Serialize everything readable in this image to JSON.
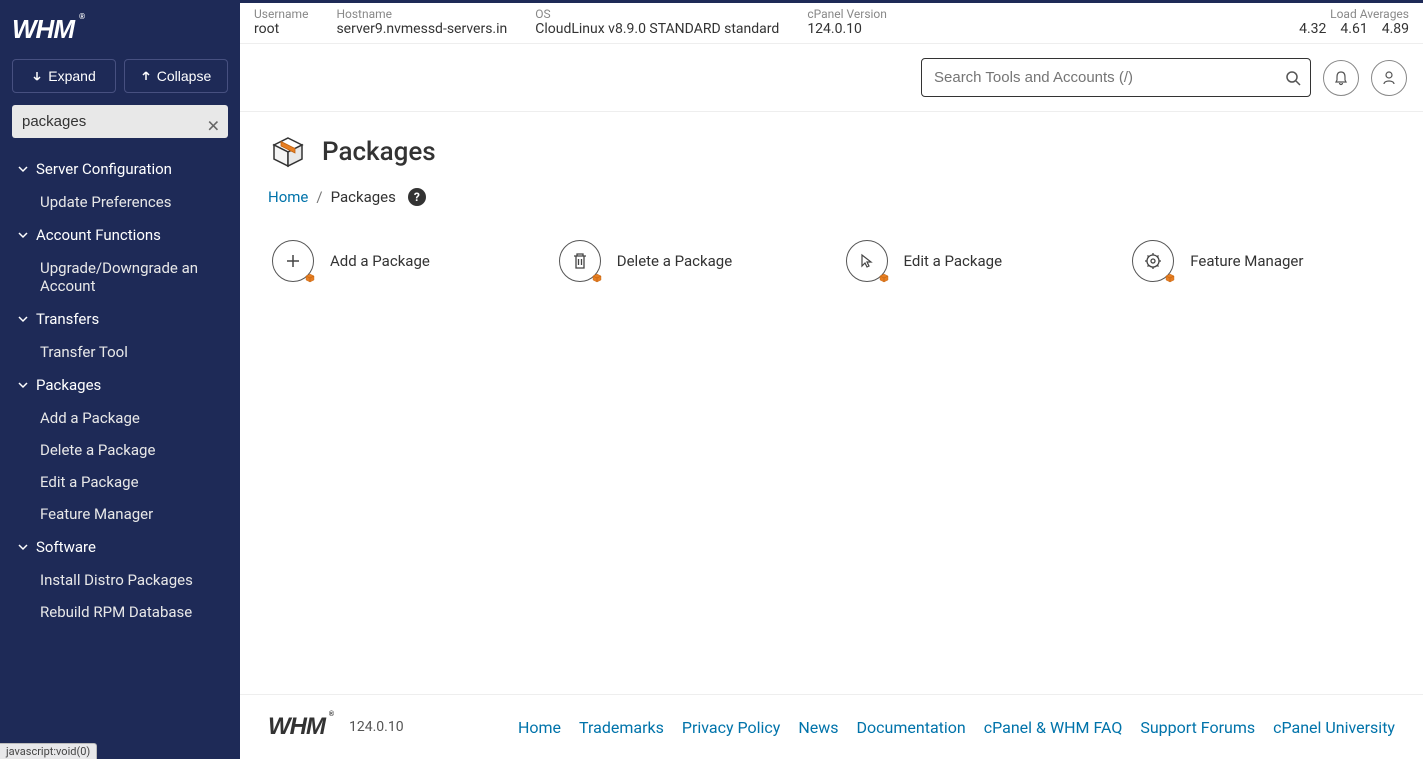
{
  "brand": "WHM",
  "sidebar": {
    "expand_label": "Expand",
    "collapse_label": "Collapse",
    "search_value": "packages",
    "groups": [
      {
        "title": "Server Configuration",
        "items": [
          "Update Preferences"
        ]
      },
      {
        "title": "Account Functions",
        "items": [
          "Upgrade/Downgrade an Account"
        ]
      },
      {
        "title": "Transfers",
        "items": [
          "Transfer Tool"
        ]
      },
      {
        "title": "Packages",
        "items": [
          "Add a Package",
          "Delete a Package",
          "Edit a Package",
          "Feature Manager"
        ]
      },
      {
        "title": "Software",
        "items": [
          "Install Distro Packages",
          "Rebuild RPM Database"
        ]
      }
    ]
  },
  "infobar": {
    "username_label": "Username",
    "username_value": "root",
    "hostname_label": "Hostname",
    "hostname_value": "server9.nvmessd-servers.in",
    "os_label": "OS",
    "os_value": "CloudLinux v8.9.0 STANDARD standard",
    "cpanel_label": "cPanel Version",
    "cpanel_value": "124.0.10",
    "load_label": "Load Averages",
    "load_values": [
      "4.32",
      "4.61",
      "4.89"
    ]
  },
  "header": {
    "search_placeholder": "Search Tools and Accounts (/)"
  },
  "page": {
    "title": "Packages",
    "breadcrumb_home": "Home",
    "breadcrumb_current": "Packages",
    "actions": [
      {
        "label": "Add a Package",
        "icon": "plus"
      },
      {
        "label": "Delete a Package",
        "icon": "trash"
      },
      {
        "label": "Edit a Package",
        "icon": "pointer"
      },
      {
        "label": "Feature Manager",
        "icon": "gear"
      }
    ]
  },
  "footer": {
    "version": "124.0.10",
    "links": [
      "Home",
      "Trademarks",
      "Privacy Policy",
      "News",
      "Documentation",
      "cPanel & WHM FAQ",
      "Support Forums",
      "cPanel University"
    ]
  },
  "status_tip": "javascript:void(0)"
}
